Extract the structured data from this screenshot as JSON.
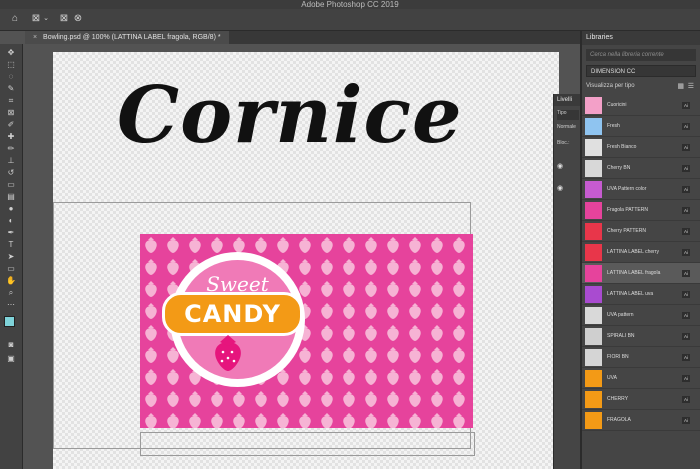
{
  "app": {
    "title": "Adobe Photoshop CC 2019"
  },
  "document_tab": {
    "title": "Bowling.psd @ 100% (LATTINA LABEL fragola, RGB/8) *",
    "close_glyph": "×"
  },
  "canvas": {
    "heading": "Cornice",
    "label_artwork": {
      "sweet": "Sweet",
      "candy": "CANDY"
    }
  },
  "layers_panel": {
    "title": "Livelli",
    "search": "Tipo",
    "blend_mode": "Normale",
    "lock": "Bloc.:"
  },
  "libraries": {
    "title": "Libraries",
    "search_placeholder": "Cerca nella libreria corrente",
    "library_name": "DIMENSION CC",
    "view_label": "Visualizza per tipo",
    "selected_item": "LATTINA LABEL fragola",
    "items": [
      {
        "name": "Cuoricini",
        "badge": "Ai",
        "thumb_color": "#f3a0c8"
      },
      {
        "name": "Fresh",
        "badge": "Ai",
        "thumb_color": "#8fc4f0"
      },
      {
        "name": "Fresh Bianco",
        "badge": "Ai",
        "thumb_color": "#e0e0e0"
      },
      {
        "name": "Cherry BN",
        "badge": "Ai",
        "thumb_color": "#d8d8d8"
      },
      {
        "name": "UVA Pattern color",
        "badge": "Ai",
        "thumb_color": "#c65bd0"
      },
      {
        "name": "Fragola PATTERN",
        "badge": "Ai",
        "thumb_color": "#e6439c"
      },
      {
        "name": "Cherry PATTERN",
        "badge": "Ai",
        "thumb_color": "#e8364a"
      },
      {
        "name": "LATTINA LABEL cherry",
        "badge": "Ai",
        "thumb_color": "#e8364a"
      },
      {
        "name": "LATTINA LABEL fragola",
        "badge": "Ai",
        "thumb_color": "#e6439c"
      },
      {
        "name": "LATTINA LABEL uva",
        "badge": "Ai",
        "thumb_color": "#a94bd0"
      },
      {
        "name": "UVA pattern",
        "badge": "Ai",
        "thumb_color": "#d9d9d9"
      },
      {
        "name": "SPIRALI BN",
        "badge": "Ai",
        "thumb_color": "#cfcfcf"
      },
      {
        "name": "FIORI BN",
        "badge": "Ai",
        "thumb_color": "#d5d5d5"
      },
      {
        "name": "UVA",
        "badge": "Ai",
        "thumb_color": "#f39a16"
      },
      {
        "name": "CHERRY",
        "badge": "Ai",
        "thumb_color": "#f39a16"
      },
      {
        "name": "FRAGOLA",
        "badge": "Ai",
        "thumb_color": "#f39a16"
      }
    ]
  },
  "colors": {
    "label_pink": "#e6439c",
    "candy_orange": "#f39a16",
    "foreground_swatch": "#7fd3d9",
    "background_swatch": "#ffffff"
  },
  "icons": [
    "home-icon",
    "marquee-icon",
    "chevron-down-icon",
    "move-icon",
    "lasso-icon",
    "crop-icon",
    "brush-icon",
    "eraser-icon",
    "text-icon",
    "hand-icon",
    "zoom-icon",
    "eye-icon"
  ]
}
